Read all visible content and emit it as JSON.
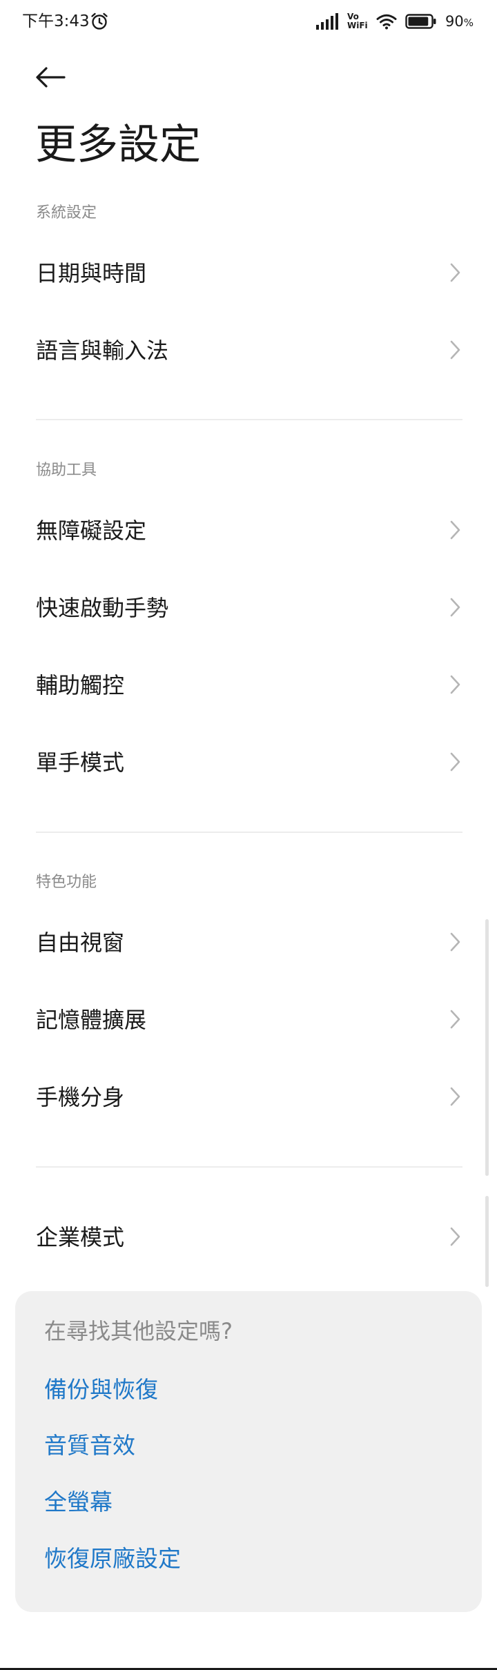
{
  "status_bar": {
    "time": "下午3:43",
    "vowifi_top": "Vo",
    "vowifi_bottom": "WiFi",
    "battery_percent": "90",
    "battery_unit": "%",
    "battery_level": 0.9
  },
  "header": {
    "title": "更多設定"
  },
  "sections": {
    "system": {
      "header": "系統設定",
      "items": [
        "日期與時間",
        "語言與輸入法"
      ]
    },
    "accessibility": {
      "header": "協助工具",
      "items": [
        "無障礙設定",
        "快速啟動手勢",
        "輔助觸控",
        "單手模式"
      ]
    },
    "features": {
      "header": "特色功能",
      "items": [
        "自由視窗",
        "記憶體擴展",
        "手機分身"
      ]
    },
    "enterprise": {
      "items": [
        "企業模式"
      ]
    }
  },
  "suggestions": {
    "title": "在尋找其他設定嗎?",
    "links": [
      "備份與恢復",
      "音質音效",
      "全螢幕",
      "恢復原廠設定"
    ]
  },
  "colors": {
    "link": "#1f78c8",
    "section_header": "#8a8a8a",
    "card_background": "#f0f0f0"
  }
}
